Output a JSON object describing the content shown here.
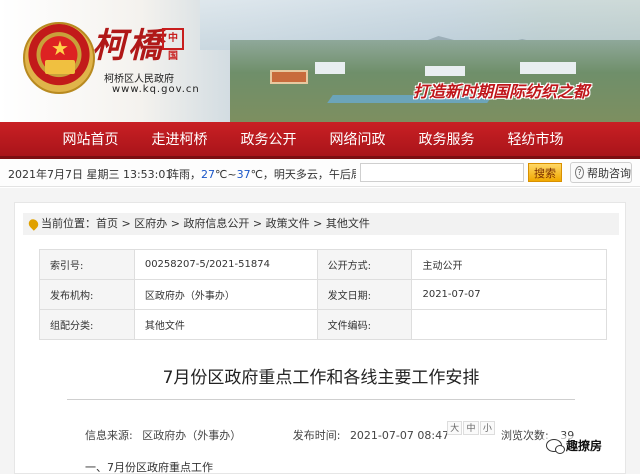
{
  "header": {
    "logo_text": "柯橋",
    "seal_text": "中国",
    "gov_name": "柯桥区人民政府",
    "url": "www.kq.gov.cn",
    "slogan": "打造新时期国际纺织之都"
  },
  "nav": {
    "items": [
      {
        "label": "网站首页"
      },
      {
        "label": "走进柯桥"
      },
      {
        "label": "政务公开"
      },
      {
        "label": "网络问政"
      },
      {
        "label": "政务服务"
      },
      {
        "label": "轻纺市场"
      }
    ]
  },
  "infobar": {
    "date": "2021年7月7日 星期三 13:53:01",
    "weather_prefix": "阵雨，",
    "temp_low": "27",
    "temp_sep": "℃~",
    "temp_high": "37",
    "weather_suffix": "℃，明天多云，午后局部有雷阵雨",
    "search_placeholder": "",
    "search_label": "搜索",
    "help_label": "帮助咨询"
  },
  "breadcrumb": {
    "prefix": "当前位置：",
    "items": [
      "首页",
      "区府办",
      "政府信息公开",
      "政策文件",
      "其他文件"
    ],
    "separator": " > "
  },
  "meta": {
    "rows": [
      {
        "l1": "索引号:",
        "v1": "00258207-5/2021-51874",
        "l2": "公开方式:",
        "v2": "主动公开"
      },
      {
        "l1": "发布机构:",
        "v1": "区政府办（外事办）",
        "l2": "发文日期:",
        "v2": "2021-07-07"
      },
      {
        "l1": "组配分类:",
        "v1": "其他文件",
        "l2": "文件编码:",
        "v2": ""
      }
    ]
  },
  "article": {
    "title": "7月份区政府重点工作和各线主要工作安排",
    "source_label": "信息来源:",
    "source": "区政府办（外事办）",
    "time_label": "发布时间:",
    "time": "2021-07-07 08:47",
    "zoom": [
      "大",
      "中",
      "小"
    ],
    "views_label": "浏览次数:",
    "views": "39",
    "section_1": "一、7月份区政府重点工作"
  },
  "watermark": "趣撩房",
  "colors": {
    "nav_red": "#c92024",
    "title_red": "#b01818",
    "search_orange": "#f0a800",
    "temp_blue": "#1a56c8"
  }
}
